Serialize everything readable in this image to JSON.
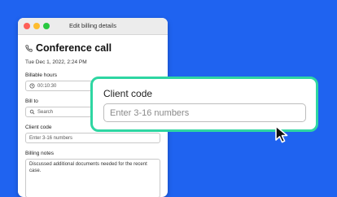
{
  "window": {
    "title": "Edit billing details",
    "heading": "Conference call",
    "date": "Tue Dec 1, 2022, 2:24 PM",
    "billable_hours": {
      "label": "Billable hours",
      "value": "00:10:30"
    },
    "bill_to": {
      "label": "Bill to",
      "placeholder": "Search"
    },
    "client_code": {
      "label": "Client code",
      "placeholder": "Enter 3-16 numbers"
    },
    "billing_notes": {
      "label": "Billing notes",
      "value": "Discussed additional documents needed for the recent case."
    }
  },
  "zoom_callout": {
    "label": "Client code",
    "placeholder": "Enter 3-16 numbers"
  },
  "icons": [
    "phone-icon",
    "clock-icon",
    "search-icon",
    "mouse-pointer-icon"
  ],
  "colors": {
    "background": "#1f63f0",
    "accent_border": "#2ed6a2",
    "close": "#fe5f57",
    "minimize": "#febc2e",
    "maximize": "#28c840"
  }
}
